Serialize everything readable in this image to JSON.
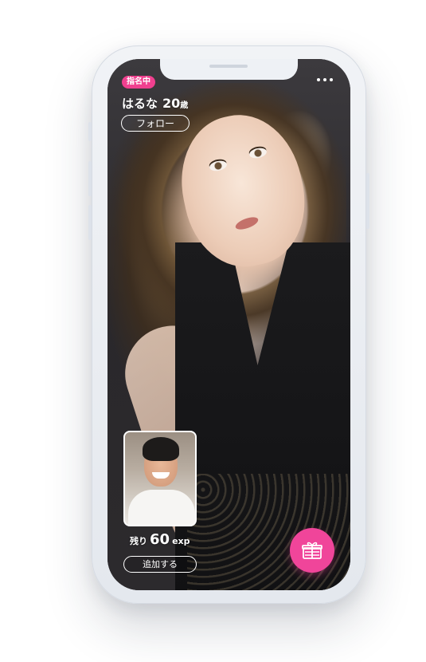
{
  "status": {
    "badge": "指名中"
  },
  "profile": {
    "name": "はるな",
    "age": "20",
    "age_unit": "歳",
    "follow_label": "フォロー"
  },
  "menu": {
    "icon": "more-dots-icon"
  },
  "self_view": {
    "icon": "self-camera-preview"
  },
  "remaining": {
    "label": "残り",
    "value": "60",
    "unit": "exp"
  },
  "actions": {
    "add_label": "追加する",
    "gift_icon": "gift-icon"
  },
  "colors": {
    "accent": "#f0459a",
    "badge": "#f0408f",
    "text": "#ffffff"
  }
}
